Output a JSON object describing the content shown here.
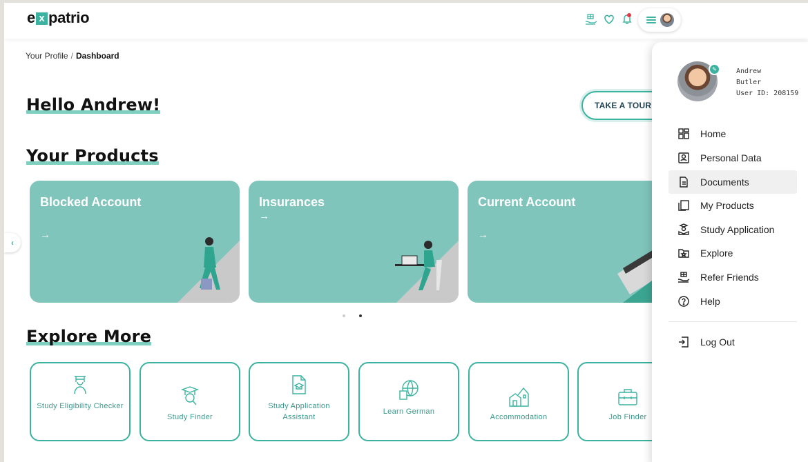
{
  "header": {
    "logo": {
      "pre": "e",
      "x": "x",
      "post": "patrio"
    },
    "icons": [
      "refer-gift-icon",
      "heart-icon",
      "bell-icon"
    ]
  },
  "breadcrumb": {
    "parent": "Your Profile",
    "separator": "/",
    "current": "Dashboard"
  },
  "greeting": "Hello Andrew!",
  "tour_button": "TAKE A TOUR",
  "products": {
    "title": "Your Products",
    "cards": [
      {
        "label": "Blocked Account",
        "arrow": "→"
      },
      {
        "label": "Insurances",
        "arrow": "→"
      },
      {
        "label": "Current Account",
        "arrow": "→"
      }
    ],
    "prev_icon": "‹"
  },
  "explore": {
    "title": "Explore More",
    "tiles": [
      {
        "label": "Study Eligibility Checker",
        "icon": "graduate-person-icon"
      },
      {
        "label": "Study Finder",
        "icon": "graduation-cap-search-icon"
      },
      {
        "label": "Study Application Assistant",
        "icon": "documents-cap-icon"
      },
      {
        "label": "Learn German",
        "icon": "globe-book-icon"
      },
      {
        "label": "Accommodation",
        "icon": "houses-icon"
      },
      {
        "label": "Job Finder",
        "icon": "briefcase-icon"
      }
    ]
  },
  "profile": {
    "first": "Andrew",
    "last": "Butler",
    "user_id": "User ID: 208159"
  },
  "menu": {
    "items": [
      {
        "label": "Home",
        "icon": "grid-icon"
      },
      {
        "label": "Personal Data",
        "icon": "id-card-icon"
      },
      {
        "label": "Documents",
        "icon": "document-icon"
      },
      {
        "label": "My Products",
        "icon": "copy-icon"
      },
      {
        "label": "Study Application",
        "icon": "graduation-person-icon"
      },
      {
        "label": "Explore",
        "icon": "folder-star-icon"
      },
      {
        "label": "Refer Friends",
        "icon": "gift-hand-icon"
      },
      {
        "label": "Help",
        "icon": "help-circle-icon"
      }
    ],
    "logout": "Log Out",
    "active_index": 2
  },
  "colors": {
    "accent": "#3bb3a0",
    "card": "#7fc5bc",
    "highlight": "#7fcfc1"
  }
}
